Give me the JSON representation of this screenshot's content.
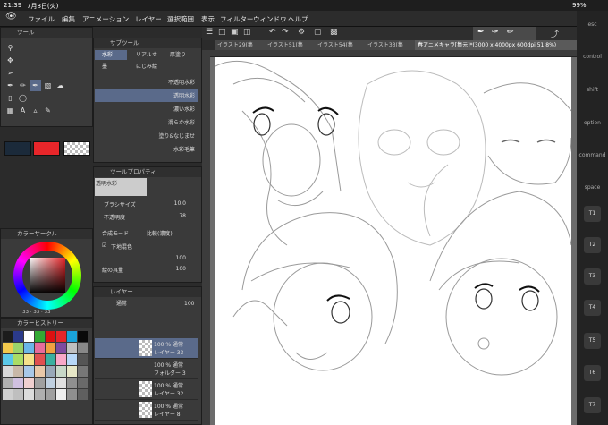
{
  "status": {
    "time": "21:39",
    "date": "7月8日(火)",
    "battery": "99%"
  },
  "menu": [
    "ファイル",
    "編集",
    "アニメーション",
    "レイヤー",
    "選択範囲",
    "表示",
    "フィルター",
    "ウィンドウ",
    "ヘルプ"
  ],
  "tabs": [
    "イラスト29(集",
    "イラスト51(集",
    "イラスト54(集",
    "イラスト33(集",
    "春アニメキャラ[集元]*(3000 x 4000px 600dpi 51.8%)"
  ],
  "tool_panel": {
    "title": "ツール"
  },
  "subtool_panel": {
    "title": "サブツール",
    "tabs": [
      "水彩",
      "リアルホ",
      "厚塗り",
      "墨",
      "にじみ絵"
    ],
    "brushes": [
      "不透明水彩",
      "透明水彩",
      "濃い水彩",
      "滑らか水彩",
      "塗り&なじませ",
      "水彩毛筆"
    ]
  },
  "tool_property": {
    "title": "ツールプロパティ",
    "tool_name": "透明水彩",
    "brush_size_label": "ブラシサイズ",
    "brush_size": "10.0",
    "opacity_label": "不透明度",
    "opacity": "78",
    "blend_label": "合成モード",
    "blend_value": "比較(濃度)",
    "underlay_label": "下地混色",
    "underlay_value": "100",
    "paint_label": "絵の具量",
    "paint_value": "100"
  },
  "color_circle": {
    "title": "カラーサークル",
    "readout": "33 · 33 · 33",
    "main_color": "#e8262a",
    "sub_color": "#1b2a3a"
  },
  "color_history": {
    "title": "カラーヒストリー",
    "colors": [
      "#1c1c1c",
      "#2b3a8a",
      "#ffffff",
      "#33aa33",
      "#d11",
      "#e6262a",
      "#1aa3d9",
      "#0a0a0a",
      "#f2c94c",
      "#9bd36b",
      "#6bb6e8",
      "#e86b9b",
      "#f0a040",
      "#7d4aa0",
      "#c0c0c0",
      "#888",
      "#5ac8e8",
      "#aadd66",
      "#f5e18a",
      "#e05050",
      "#3ab0a0",
      "#f8a8c8",
      "#b8d8f8",
      "#555",
      "#d8d8d8",
      "#c8b8a8",
      "#a8c8e8",
      "#e8c8a8",
      "#98a8b8",
      "#c8d8c8",
      "#e8e8c8",
      "#777",
      "#b0b0b0",
      "#d0c0e0",
      "#f0d0d0",
      "#a0a0a0",
      "#c0d0e0",
      "#e0e0e0",
      "#909090",
      "#6a6a6a",
      "#cfcfcf",
      "#bfbfbf",
      "#dcdcdc",
      "#afafaf",
      "#9f9f9f",
      "#efefef",
      "#8f8f8f",
      "#5f5f5f"
    ]
  },
  "layer_panel": {
    "title": "レイヤー",
    "blend": "通常",
    "opacity": "100",
    "rows": [
      {
        "pct": "100 % 通常",
        "name": "レイヤー 33",
        "selected": true
      },
      {
        "pct": "100 % 通常",
        "name": "フォルダー 3",
        "selected": false
      },
      {
        "pct": "100 % 通常",
        "name": "レイヤー 32",
        "selected": false
      },
      {
        "pct": "100 % 通常",
        "name": "レイヤー 8",
        "selected": false
      },
      {
        "pct": "100 % 通常",
        "name": "",
        "selected": false
      }
    ]
  },
  "right_keys": [
    "esc",
    "control",
    "shift",
    "option",
    "command",
    "space"
  ],
  "t_keys": [
    "T1",
    "T2",
    "T3",
    "T4",
    "T5",
    "T6",
    "T7"
  ]
}
